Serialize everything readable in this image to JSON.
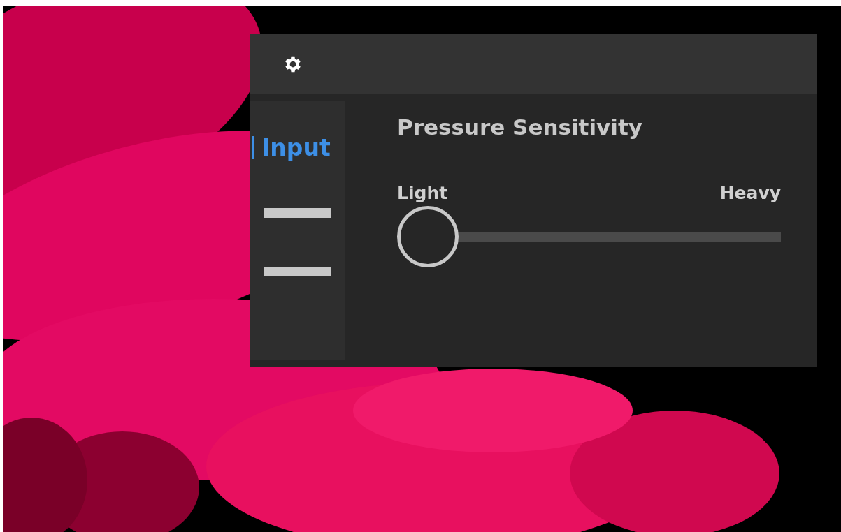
{
  "settings_panel": {
    "tabs": [
      {
        "kind": "label",
        "label": "Input",
        "selected": true
      },
      {
        "kind": "bar",
        "selected": false
      },
      {
        "kind": "bar",
        "selected": false
      }
    ],
    "section_title": "Pressure Sensitivity",
    "slider": {
      "min_label": "Light",
      "max_label": "Heavy",
      "level": 0
    }
  }
}
